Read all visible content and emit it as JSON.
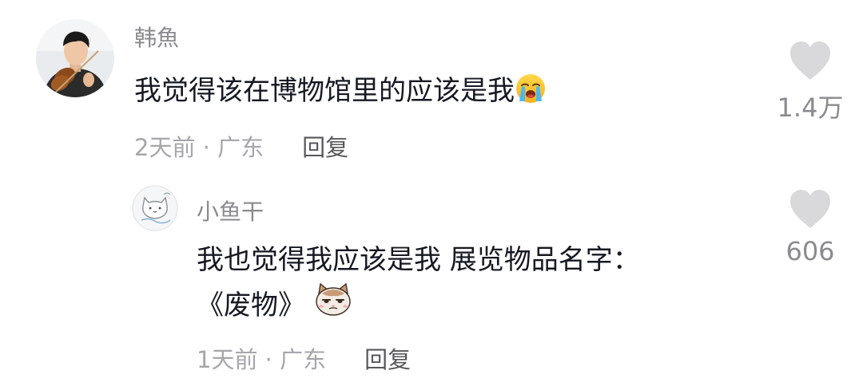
{
  "comments": [
    {
      "username": "韩魚",
      "text": "我觉得该在博物馆里的应该是我",
      "emoji_icon": "loudly-crying-face-emoji",
      "time": "2天前",
      "separator": " · ",
      "location": "广东",
      "reply_label": "回复",
      "likes": "1.4万",
      "avatar_icon": "user-avatar-violinist"
    },
    {
      "username": "小鱼干",
      "text_line1": "我也觉得我应该是我 展览物品名字：",
      "text_line2": "《废物》",
      "emoji_icon": "cat-face-sticker",
      "time": "1天前",
      "separator": " · ",
      "location": "广东",
      "reply_label": "回复",
      "likes": "606",
      "avatar_icon": "user-avatar-cat-doodle"
    }
  ],
  "colors": {
    "username": "#8a8a8f",
    "text": "#161823",
    "meta": "#a6a6ab",
    "reply": "#57575c",
    "heart": "#d9d9dc"
  }
}
